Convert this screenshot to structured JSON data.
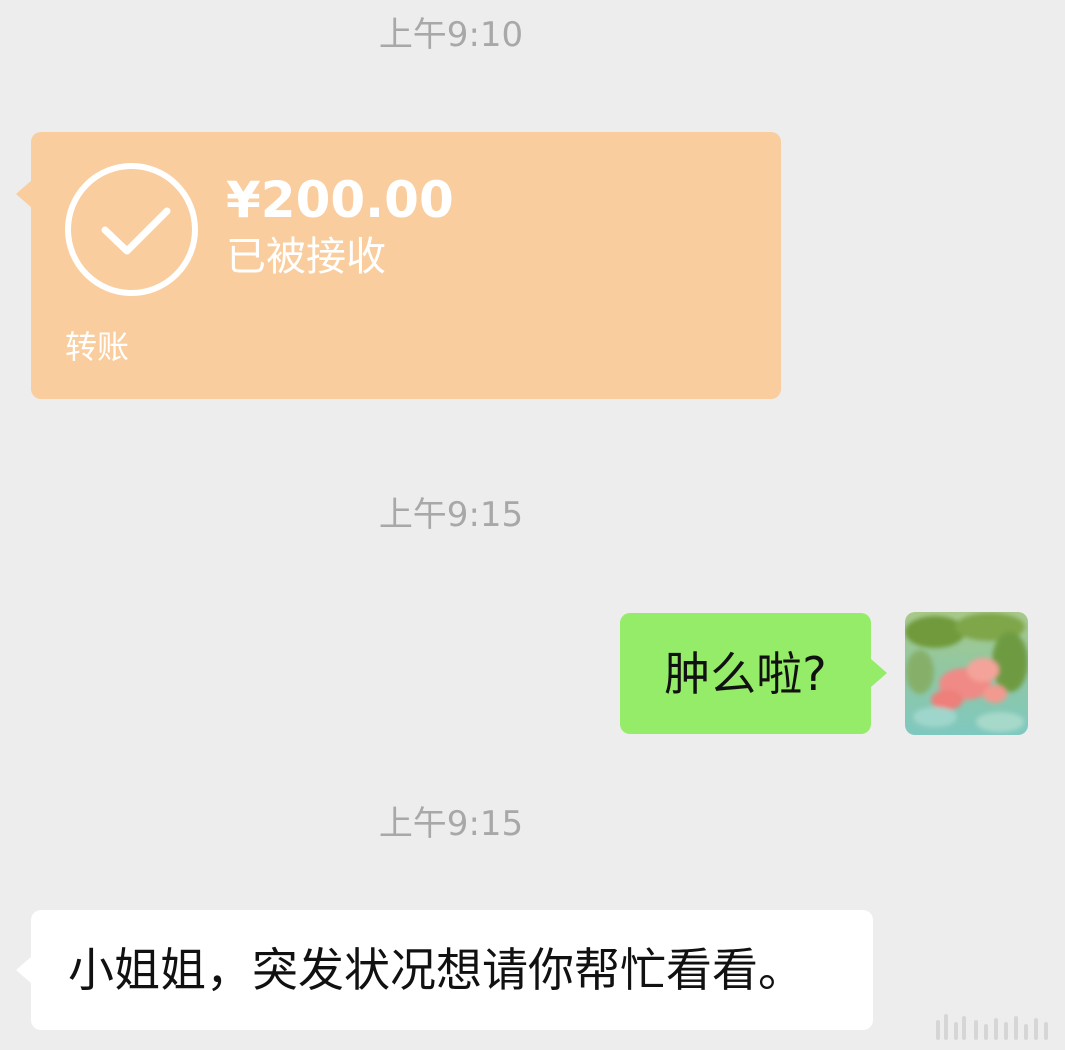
{
  "timestamps": [
    "上午9:10",
    "上午9:15",
    "上午9:15"
  ],
  "transfer": {
    "amount": "¥200.00",
    "status": "已被接收",
    "label": "转账",
    "icon": "check-circle-icon",
    "color": "#f9cd9d"
  },
  "outgoing_message": {
    "text": "肿么啦?",
    "color": "#95ec69"
  },
  "incoming_message": {
    "text": "小姐姐，突发状况想请你帮忙看看。",
    "color": "#ffffff"
  },
  "background_color": "#ededed"
}
